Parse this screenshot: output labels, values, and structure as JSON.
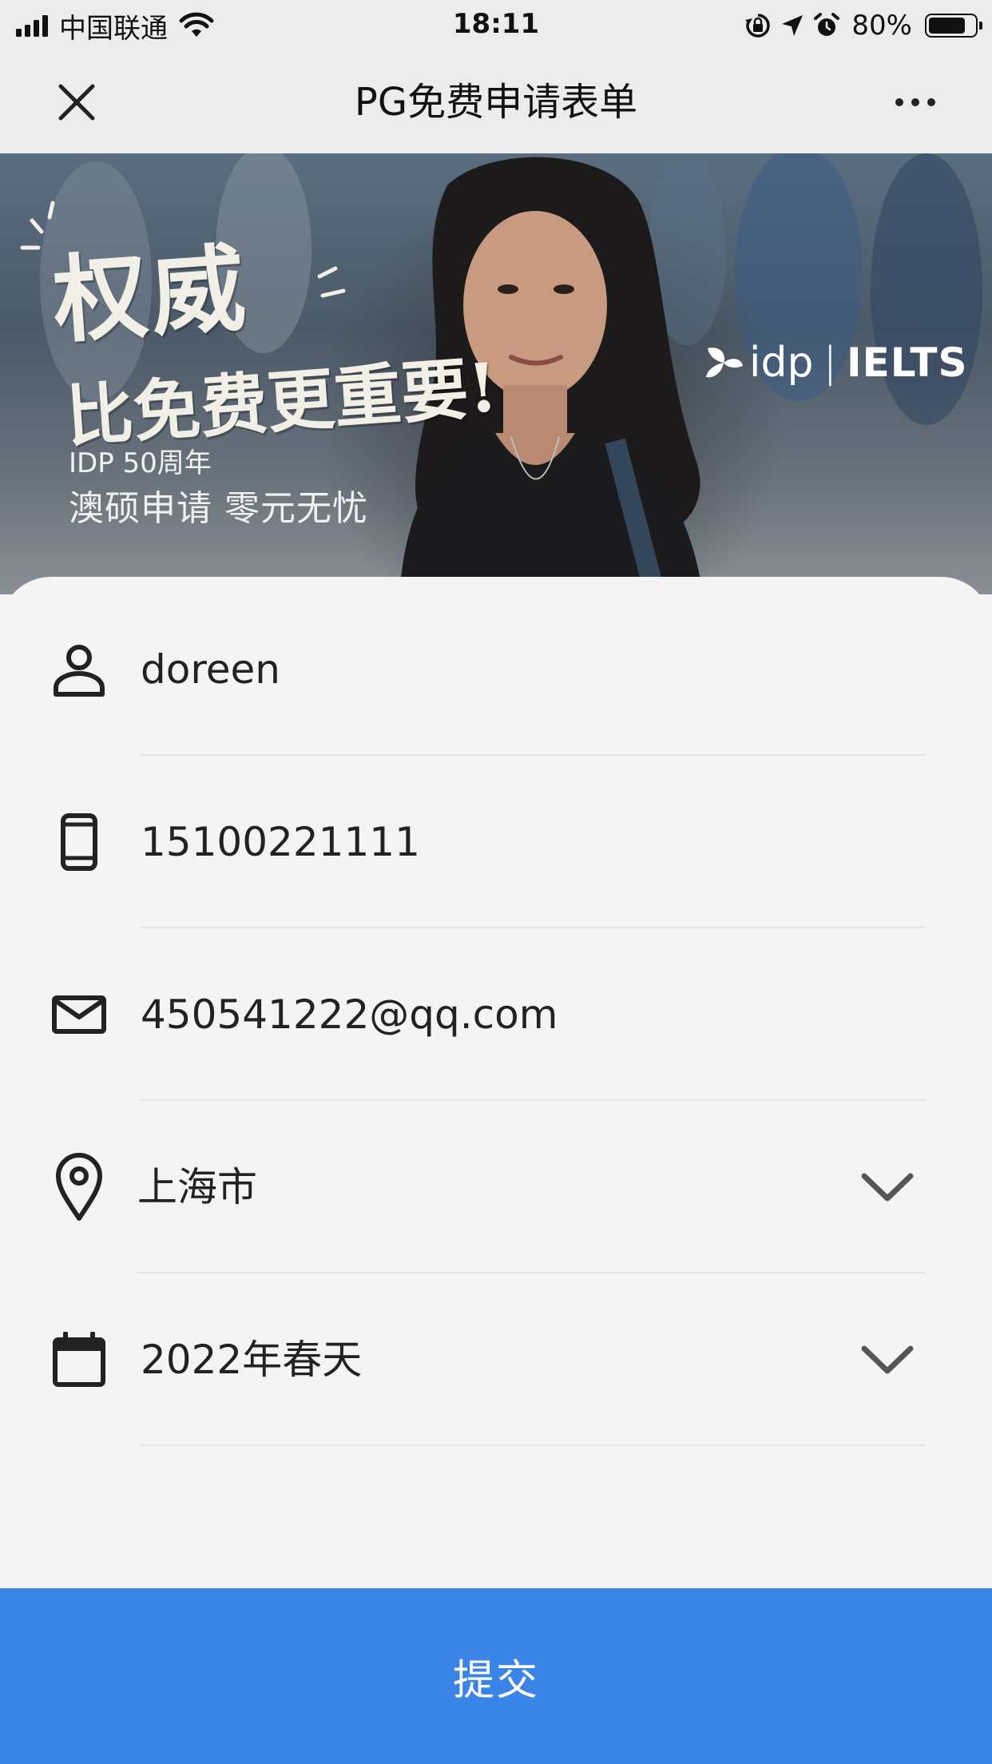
{
  "status_bar": {
    "carrier": "中国联通",
    "time": "18:11",
    "battery": "80%",
    "battery_level": 0.8,
    "icons": [
      "signal-icon",
      "wifi-icon",
      "rotation-lock-icon",
      "location-icon",
      "alarm-icon",
      "battery-icon"
    ]
  },
  "nav": {
    "title": "PG免费申请表单",
    "close_icon": "close-icon",
    "more_icon": "more-icon"
  },
  "banner": {
    "headline_line1": "权威",
    "headline_line2": "比免费更重要!",
    "sub_line1": "IDP 50周年",
    "sub_line2": "澳硕申请 零元无忧",
    "logo_idp": "idp",
    "logo_sep": "|",
    "logo_ielts": "IELTS"
  },
  "form": {
    "fields": [
      {
        "icon": "person-icon",
        "value": "doreen"
      },
      {
        "icon": "phone-icon",
        "value": "15100221111"
      },
      {
        "icon": "mail-icon",
        "value": "450541222@qq.com"
      },
      {
        "icon": "location-pin-icon",
        "value": "上海市",
        "dropdown": true
      },
      {
        "icon": "calendar-icon",
        "value": "2022年春天",
        "dropdown": true
      }
    ]
  },
  "submit": {
    "label": "提交"
  },
  "colors": {
    "accent": "#3a84e8",
    "background": "#f4f4f4",
    "nav_background": "#ececec",
    "text": "#222222"
  }
}
